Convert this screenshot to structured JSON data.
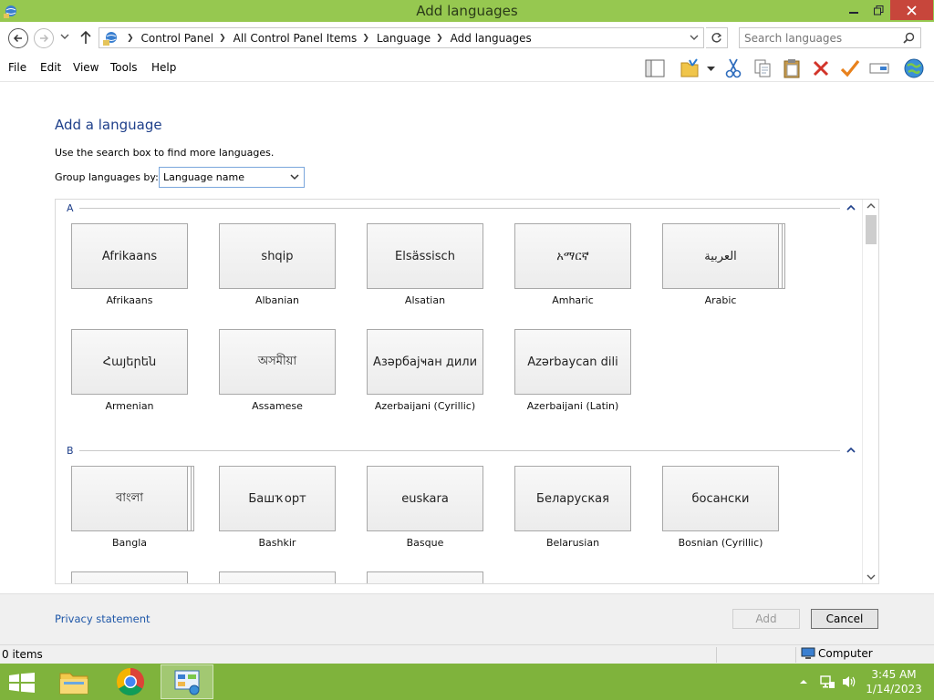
{
  "window": {
    "title": "Add languages",
    "controls": {
      "minimize": "—",
      "maximize": "❐",
      "close": "✕"
    }
  },
  "address": {
    "breadcrumbs": [
      "Control Panel",
      "All Control Panel Items",
      "Language",
      "Add languages"
    ],
    "search_placeholder": "Search languages"
  },
  "menu": [
    "File",
    "Edit",
    "View",
    "Tools",
    "Help"
  ],
  "toolbar_icons": [
    "pane-icon",
    "properties-icon",
    "cut-icon",
    "copy-icon",
    "paste-icon",
    "delete-icon",
    "check-icon",
    "rename-icon",
    "globe-icon"
  ],
  "main": {
    "heading": "Add a language",
    "hint": "Use the search box to find more languages.",
    "group_label": "Group languages by:",
    "group_value": "Language name",
    "groups": [
      {
        "letter": "A",
        "languages": [
          {
            "native": "Afrikaans",
            "name": "Afrikaans",
            "stacked": false
          },
          {
            "native": "shqip",
            "name": "Albanian",
            "stacked": false
          },
          {
            "native": "Elsässisch",
            "name": "Alsatian",
            "stacked": false
          },
          {
            "native": "አማርኛ",
            "name": "Amharic",
            "stacked": false
          },
          {
            "native": "العربية",
            "name": "Arabic",
            "stacked": true
          },
          {
            "native": "Հայերեն",
            "name": "Armenian",
            "stacked": false
          },
          {
            "native": "অসমীয়া",
            "name": "Assamese",
            "stacked": false
          },
          {
            "native": "Азәрбајҹан дили",
            "name": "Azerbaijani (Cyrillic)",
            "stacked": false
          },
          {
            "native": "Azərbaycan dili",
            "name": "Azerbaijani (Latin)",
            "stacked": false
          }
        ]
      },
      {
        "letter": "B",
        "languages": [
          {
            "native": "বাংলা",
            "name": "Bangla",
            "stacked": true
          },
          {
            "native": "Башҡорт",
            "name": "Bashkir",
            "stacked": false
          },
          {
            "native": "euskara",
            "name": "Basque",
            "stacked": false
          },
          {
            "native": "Беларуская",
            "name": "Belarusian",
            "stacked": false
          },
          {
            "native": "босански",
            "name": "Bosnian (Cyrillic)",
            "stacked": false
          },
          {
            "native": "",
            "name": "",
            "stacked": false
          },
          {
            "native": "",
            "name": "",
            "stacked": false
          },
          {
            "native": "",
            "name": "",
            "stacked": false
          }
        ]
      }
    ]
  },
  "footer": {
    "privacy": "Privacy statement",
    "add": "Add",
    "cancel": "Cancel"
  },
  "status": {
    "items": "0 items",
    "location": "Computer"
  },
  "taskbar": {
    "time": "3:45 AM",
    "date": "1/14/2023"
  },
  "colors": {
    "titlebar": "#96c850",
    "taskbar": "#7fb33c",
    "heading": "#1e3f8a",
    "link": "#1e57a8"
  }
}
